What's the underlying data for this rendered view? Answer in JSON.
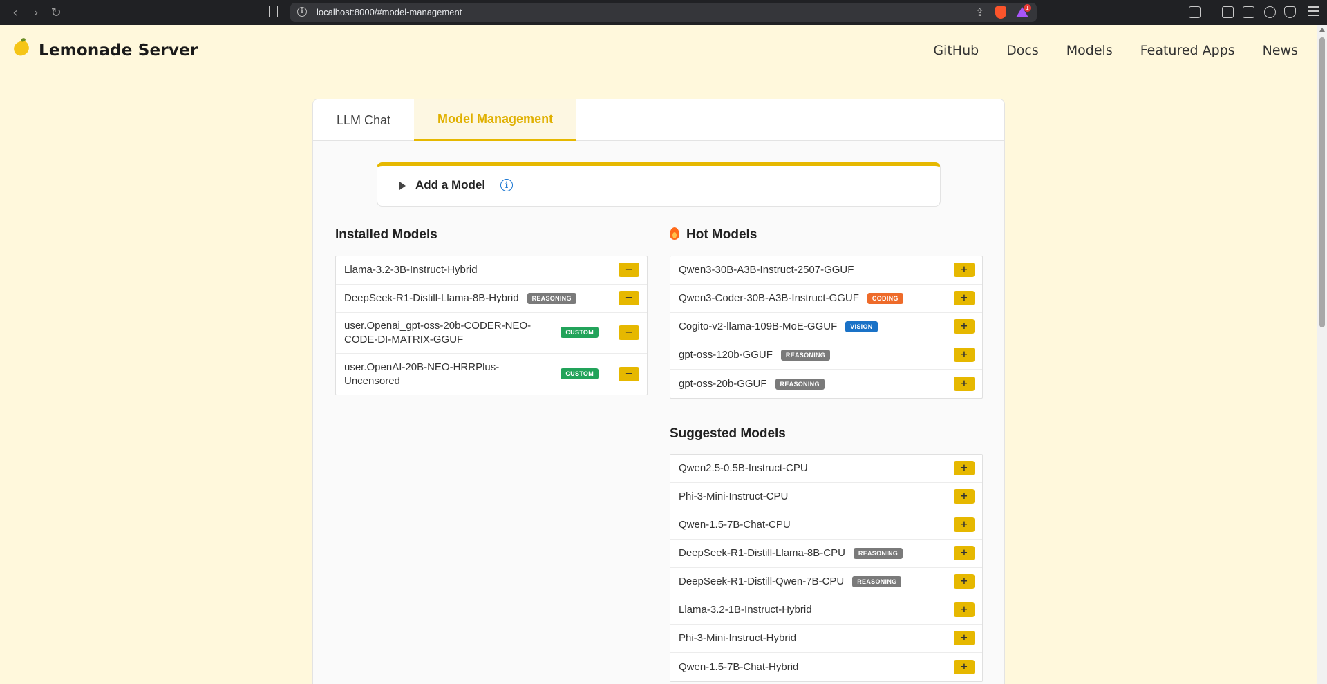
{
  "browser": {
    "url": "localhost:8000/#model-management",
    "notification_count": "1"
  },
  "site": {
    "brand": "Lemonade Server",
    "nav": [
      "GitHub",
      "Docs",
      "Models",
      "Featured Apps",
      "News"
    ]
  },
  "tabs": [
    {
      "label": "LLM Chat",
      "active": false
    },
    {
      "label": "Model Management",
      "active": true
    }
  ],
  "add_model": {
    "label": "Add a Model"
  },
  "installed": {
    "title": "Installed Models",
    "items": [
      {
        "name": "Llama-3.2-3B-Instruct-Hybrid",
        "badge": "",
        "action": "−"
      },
      {
        "name": "DeepSeek-R1-Distill-Llama-8B-Hybrid",
        "badge": "REASONING",
        "action": "−"
      },
      {
        "name": "user.Openai_gpt-oss-20b-CODER-NEO-CODE-DI-MATRIX-GGUF",
        "badge": "CUSTOM",
        "action": "−"
      },
      {
        "name": "user.OpenAI-20B-NEO-HRRPlus-Uncensored",
        "badge": "CUSTOM",
        "action": "−"
      }
    ]
  },
  "hot": {
    "title": "Hot Models",
    "items": [
      {
        "name": "Qwen3-30B-A3B-Instruct-2507-GGUF",
        "badge": "",
        "action": "+"
      },
      {
        "name": "Qwen3-Coder-30B-A3B-Instruct-GGUF",
        "badge": "CODING",
        "action": "+"
      },
      {
        "name": "Cogito-v2-llama-109B-MoE-GGUF",
        "badge": "VISION",
        "action": "+"
      },
      {
        "name": "gpt-oss-120b-GGUF",
        "badge": "REASONING",
        "action": "+"
      },
      {
        "name": "gpt-oss-20b-GGUF",
        "badge": "REASONING",
        "action": "+"
      }
    ]
  },
  "suggested": {
    "title": "Suggested Models",
    "items": [
      {
        "name": "Qwen2.5-0.5B-Instruct-CPU",
        "badge": "",
        "action": "+"
      },
      {
        "name": "Phi-3-Mini-Instruct-CPU",
        "badge": "",
        "action": "+"
      },
      {
        "name": "Qwen-1.5-7B-Chat-CPU",
        "badge": "",
        "action": "+"
      },
      {
        "name": "DeepSeek-R1-Distill-Llama-8B-CPU",
        "badge": "REASONING",
        "action": "+"
      },
      {
        "name": "DeepSeek-R1-Distill-Qwen-7B-CPU",
        "badge": "REASONING",
        "action": "+"
      },
      {
        "name": "Llama-3.2-1B-Instruct-Hybrid",
        "badge": "",
        "action": "+"
      },
      {
        "name": "Phi-3-Mini-Instruct-Hybrid",
        "badge": "",
        "action": "+"
      },
      {
        "name": "Qwen-1.5-7B-Chat-Hybrid",
        "badge": "",
        "action": "+"
      }
    ]
  },
  "colors": {
    "accent": "#e6b800",
    "page_bg": "#fff8dc",
    "reasoning": "#7a7a7a",
    "custom": "#22a35a",
    "coding": "#ee6b2a",
    "vision": "#1a72c7"
  }
}
